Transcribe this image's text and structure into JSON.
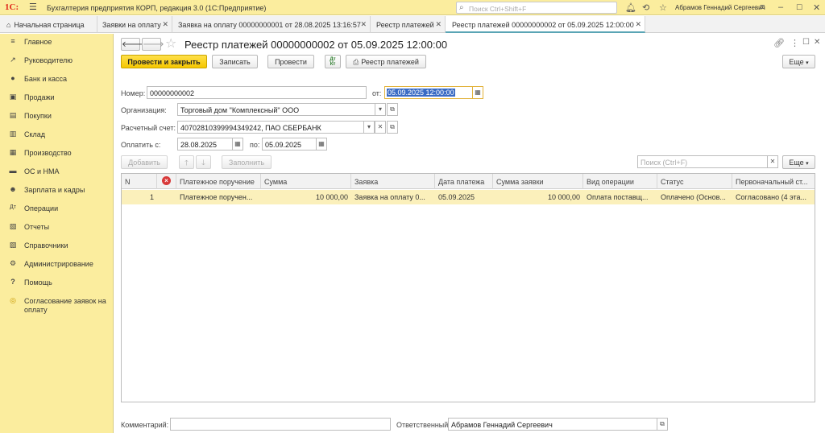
{
  "app": {
    "logo": "1С:",
    "title": "Бухгалтерия предприятия КОРП, редакция 3.0  (1С:Предприятие)",
    "search_placeholder": "Поиск Ctrl+Shift+F",
    "user": "Абрамов Геннадий Сергеевич"
  },
  "tabs": [
    {
      "label": "Начальная страница"
    },
    {
      "label": "Заявки на оплату"
    },
    {
      "label": "Заявка на оплату  00000000001 от 28.08.2025 13:16:57"
    },
    {
      "label": "Реестр платежей"
    },
    {
      "label": "Реестр платежей  00000000002 от 05.09.2025 12:00:00"
    }
  ],
  "sidebar": {
    "items": [
      {
        "label": "Главное",
        "icon": "≡"
      },
      {
        "label": "Руководителю",
        "icon": "↗"
      },
      {
        "label": "Банк и касса",
        "icon": "●"
      },
      {
        "label": "Продажи",
        "icon": "▣"
      },
      {
        "label": "Покупки",
        "icon": "▤"
      },
      {
        "label": "Склад",
        "icon": "▥"
      },
      {
        "label": "Производство",
        "icon": "▦"
      },
      {
        "label": "ОС и НМА",
        "icon": "▬"
      },
      {
        "label": "Зарплата и кадры",
        "icon": "☻"
      },
      {
        "label": "Операции",
        "icon": "Дт"
      },
      {
        "label": "Отчеты",
        "icon": "▧"
      },
      {
        "label": "Справочники",
        "icon": "▨"
      },
      {
        "label": "Администрирование",
        "icon": "⚙"
      },
      {
        "label": "Помощь",
        "icon": "?"
      },
      {
        "label": "Согласование заявок на",
        "label2": "оплату",
        "icon": "◎"
      }
    ]
  },
  "doc": {
    "title": "Реестр платежей  00000000002 от 05.09.2025 12:00:00",
    "toolbar": {
      "post_close": "Провести и закрыть",
      "save": "Записать",
      "post": "Провести",
      "dtkt": "Дт\nКт",
      "registry": "Реестр платежей",
      "more": "Еще"
    },
    "fields": {
      "number_label": "Номер:",
      "number_value": "00000000002",
      "date_label": "от:",
      "date_value": "05.09.2025 12:00:00",
      "org_label": "Организация:",
      "org_value": "Торговый дом \"Комплексный\" ООО",
      "account_label": "Расчетный счет:",
      "account_value": "40702810399994349242, ПАО СБЕРБАНК",
      "pay_from_label": "Оплатить с:",
      "pay_from_value": "28.08.2025",
      "pay_to_label": "по:",
      "pay_to_value": "05.09.2025"
    },
    "table_toolbar": {
      "add": "Добавить",
      "fill": "Заполнить",
      "search_placeholder": "Поиск (Ctrl+F)",
      "more": "Еще"
    },
    "table": {
      "columns": [
        "N",
        "Платежное поручение",
        "Сумма",
        "Заявка",
        "Дата платежа",
        "Сумма заявки",
        "Вид операции",
        "Статус",
        "Первоначальный ст..."
      ],
      "rows": [
        [
          "1",
          "Платежное поручен...",
          "10 000,00",
          "Заявка на оплату  0...",
          "05.09.2025",
          "10 000,00",
          "Оплата поставщ...",
          "Оплачено (Основ...",
          "Согласовано (4 эта..."
        ]
      ]
    },
    "footer": {
      "comment_label": "Комментарий:",
      "comment_value": "",
      "responsible_label": "Ответственный:",
      "responsible_value": "Абрамов Геннадий Сергеевич"
    }
  }
}
